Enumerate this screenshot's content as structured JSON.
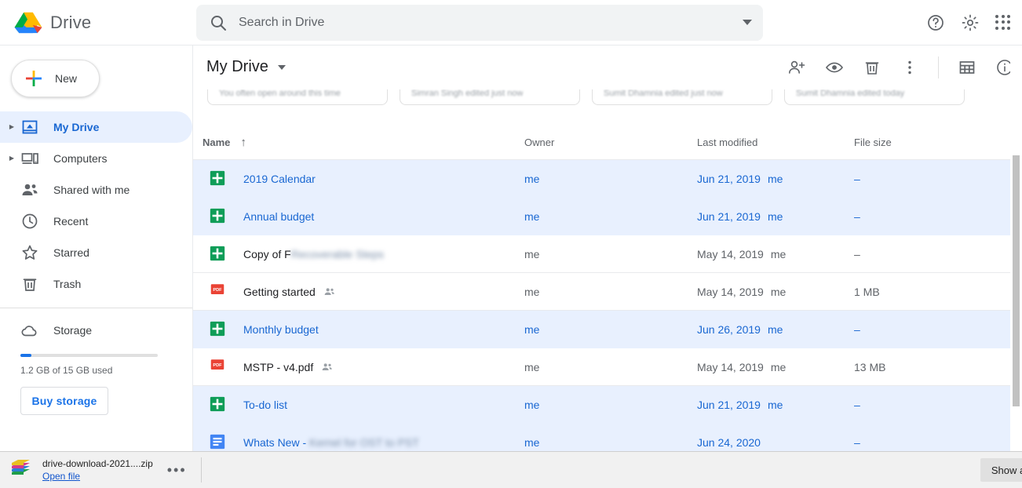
{
  "app": {
    "brand": "Drive",
    "logo_colors": {
      "blue": "#2684fc",
      "green": "#00ac47",
      "yellow": "#ffba00",
      "red": "#ea4335"
    }
  },
  "search": {
    "placeholder": "Search in Drive",
    "value": "",
    "icon": "search-icon",
    "options_icon": "chevron-down-icon"
  },
  "topbar_icons": [
    {
      "name": "help-icon",
      "label": "Support"
    },
    {
      "name": "gear-icon",
      "label": "Settings"
    },
    {
      "name": "apps-grid-icon",
      "label": "Google apps"
    }
  ],
  "sidebar": {
    "new_button": {
      "label": "New",
      "icon": "plus-icon"
    },
    "items": [
      {
        "label": "My Drive",
        "icon": "my-drive-icon",
        "active": true,
        "expandable": true
      },
      {
        "label": "Computers",
        "icon": "computer-icon",
        "active": false,
        "expandable": true
      },
      {
        "label": "Shared with me",
        "icon": "people-icon",
        "active": false,
        "expandable": false
      },
      {
        "label": "Recent",
        "icon": "clock-icon",
        "active": false,
        "expandable": false
      },
      {
        "label": "Starred",
        "icon": "star-icon",
        "active": false,
        "expandable": false
      },
      {
        "label": "Trash",
        "icon": "trash-icon",
        "active": false,
        "expandable": false
      }
    ],
    "storage": {
      "label": "Storage",
      "icon": "cloud-icon",
      "used_text": "1.2 GB of 15 GB used",
      "percent": 8,
      "buy_label": "Buy storage",
      "accent": "#1a73e8"
    }
  },
  "main": {
    "breadcrumb": "My Drive",
    "toolbar_icons": [
      {
        "name": "add-person-icon",
        "label": "Share"
      },
      {
        "name": "eye-icon",
        "label": "Preview"
      },
      {
        "name": "trash-icon",
        "label": "Remove"
      },
      {
        "name": "more-vert-icon",
        "label": "More actions"
      },
      {
        "name": "grid-view-icon",
        "label": "Grid view"
      },
      {
        "name": "info-icon",
        "label": "View details"
      }
    ],
    "quick_access_cards": [
      {
        "text": "You often open around this time"
      },
      {
        "text": "Simran Singh edited just now"
      },
      {
        "text": "Sumit Dhamnia edited just now"
      },
      {
        "text": "Sumit Dhamnia edited today"
      }
    ],
    "columns": {
      "name": "Name",
      "sort_arrow": "↑",
      "owner": "Owner",
      "modified": "Last modified",
      "size": "File size"
    },
    "rows": [
      {
        "name": "2019 Calendar",
        "name_redacted": "",
        "icon": "sheets-icon",
        "shared": false,
        "owner": "me",
        "modified": "Jun 21, 2019",
        "modified_by": "me",
        "size": "–",
        "selected": true
      },
      {
        "name": "Annual budget",
        "name_redacted": "",
        "icon": "sheets-icon",
        "shared": false,
        "owner": "me",
        "modified": "Jun 21, 2019",
        "modified_by": "me",
        "size": "–",
        "selected": true
      },
      {
        "name": "Copy of F",
        "name_redacted": "Recoverable Steps",
        "icon": "sheets-icon",
        "shared": false,
        "owner": "me",
        "modified": "May 14, 2019",
        "modified_by": "me",
        "size": "–",
        "selected": false
      },
      {
        "name": "Getting started",
        "name_redacted": "",
        "icon": "pdf-icon",
        "shared": true,
        "owner": "me",
        "modified": "May 14, 2019",
        "modified_by": "me",
        "size": "1 MB",
        "selected": false
      },
      {
        "name": "Monthly budget",
        "name_redacted": "",
        "icon": "sheets-icon",
        "shared": false,
        "owner": "me",
        "modified": "Jun 26, 2019",
        "modified_by": "me",
        "size": "–",
        "selected": true
      },
      {
        "name": "MSTP - v4.pdf",
        "name_redacted": "",
        "icon": "pdf-icon",
        "shared": true,
        "owner": "me",
        "modified": "May 14, 2019",
        "modified_by": "me",
        "size": "13 MB",
        "selected": false
      },
      {
        "name": "To-do list",
        "name_redacted": "",
        "icon": "sheets-icon",
        "shared": false,
        "owner": "me",
        "modified": "Jun 21, 2019",
        "modified_by": "me",
        "size": "–",
        "selected": true
      },
      {
        "name": "Whats New - ",
        "name_redacted": "Kernel for OST to PST",
        "icon": "docs-icon",
        "shared": false,
        "owner": "me",
        "modified": "Jun 24, 2020",
        "modified_by": "",
        "size": "–",
        "selected": true
      }
    ]
  },
  "download_bar": {
    "file_name": "drive-download-2021....zip",
    "open_link": "Open file",
    "menu": "•••",
    "show_all": "Show all",
    "icon": "zip-archive-icon"
  }
}
